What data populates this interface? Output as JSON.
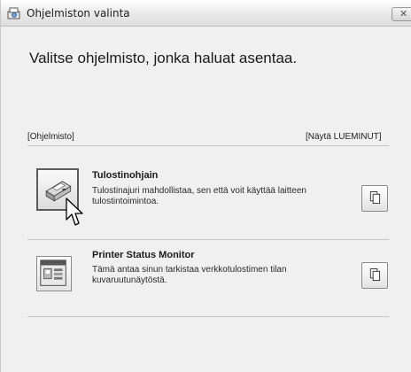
{
  "window": {
    "title": "Ohjelmiston valinta",
    "close_glyph": "✕"
  },
  "main": {
    "heading": "Valitse ohjelmisto, jonka haluat asentaa.",
    "software_label": "[Ohjelmisto]",
    "readme_label": "[Näytä LUEMINUT]"
  },
  "items": [
    {
      "title": "Tulostinohjain",
      "description": "Tulostinajuri mahdollistaa, sen että voit käyttää laitteen tulostintoimintoa.",
      "icon": "printer-icon",
      "readme_icon": "document-icon"
    },
    {
      "title": "Printer Status Monitor",
      "description": "Tämä antaa sinun tarkistaa verkkotulostimen tilan kuvaruutunäytöstä.",
      "icon": "status-monitor-icon",
      "readme_icon": "document-icon"
    }
  ],
  "colors": {
    "background": "#f0f0f0",
    "divider": "#c6c6c6"
  }
}
